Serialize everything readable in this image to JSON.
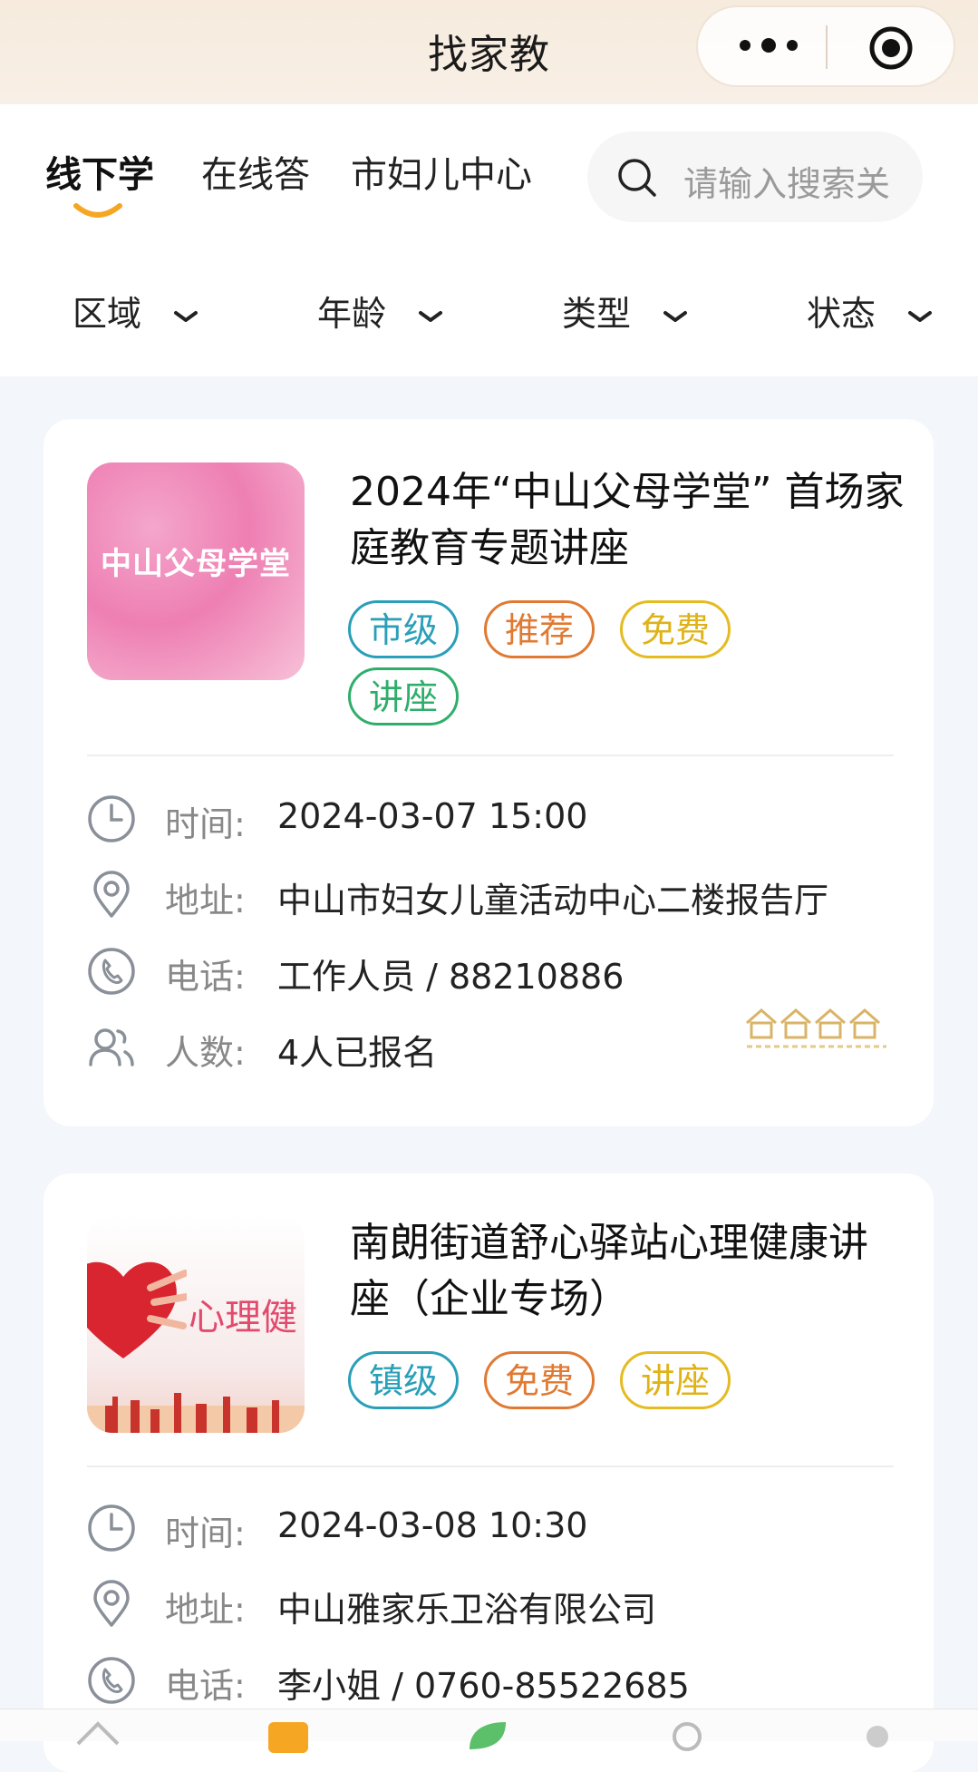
{
  "header": {
    "title": "找家教"
  },
  "topnav": {
    "tabs": [
      {
        "label": "线下学",
        "active": true
      },
      {
        "label": "在线答",
        "active": false
      },
      {
        "label": "市妇儿中心",
        "active": false
      }
    ],
    "search": {
      "placeholder": "请输入搜索关"
    }
  },
  "filters": [
    {
      "label": "区域"
    },
    {
      "label": "年龄"
    },
    {
      "label": "类型"
    },
    {
      "label": "状态"
    }
  ],
  "events": [
    {
      "thumb_text": "中山父母学堂",
      "title": "2024年“中山父母学堂” 首场家庭教育专题讲座",
      "tags": [
        "市级",
        "推荐",
        "免费",
        "讲座"
      ],
      "time_label": "时间:",
      "time": "2024-03-07 15:00",
      "address_label": "地址:",
      "address": "中山市妇女儿童活动中心二楼报告厅",
      "phone_label": "电话:",
      "phone": "工作人员 / 88210886",
      "count_label": "人数:",
      "count": "4人已报名"
    },
    {
      "thumb_text": "心理健",
      "title": "南朗街道舒心驿站心理健康讲座（企业专场）",
      "tags": [
        "镇级",
        "免费",
        "讲座"
      ],
      "time_label": "时间:",
      "time": "2024-03-08 10:30",
      "address_label": "地址:",
      "address": "中山雅家乐卫浴有限公司",
      "phone_label": "电话:",
      "phone": "李小姐 / 0760-85522685"
    }
  ],
  "colors": {
    "tag_blue": "#2a9fb8",
    "tag_orange": "#e07a33",
    "tag_yellow": "#dfb318",
    "tag_green": "#2fae6b",
    "accent": "#f5a623"
  }
}
